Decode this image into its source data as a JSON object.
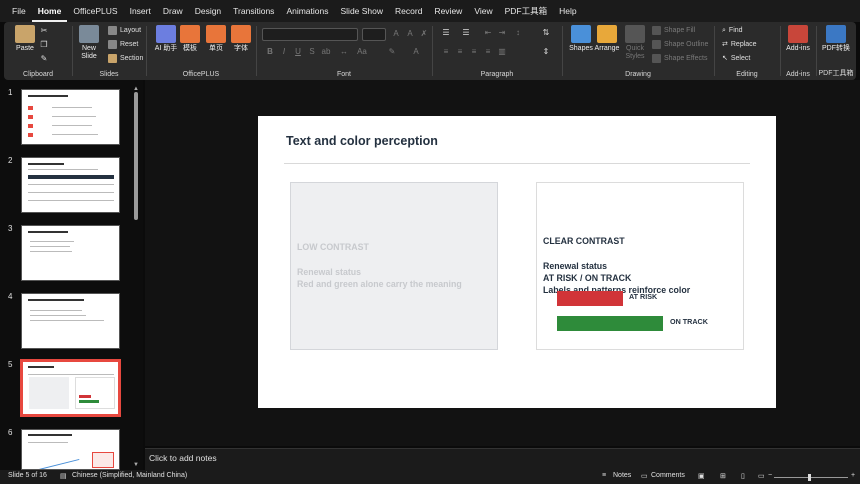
{
  "menu": [
    "File",
    "Home",
    "OfficePLUS",
    "Insert",
    "Draw",
    "Design",
    "Transitions",
    "Animations",
    "Slide Show",
    "Record",
    "Review",
    "View",
    "PDF工具箱",
    "Help"
  ],
  "active_menu": "Home",
  "ribbon": {
    "clipboard": {
      "label": "Clipboard",
      "paste": "Paste"
    },
    "slides": {
      "label": "Slides",
      "new_slide": "New Slide",
      "layout": "Layout",
      "reset": "Reset",
      "section": "Section"
    },
    "officeplus": {
      "label": "OfficePLUS",
      "ai": "AI 助手",
      "template": "模板",
      "single_page": "单页",
      "font_tool": "字体"
    },
    "font": {
      "label": "Font"
    },
    "paragraph": {
      "label": "Paragraph"
    },
    "drawing": {
      "label": "Drawing",
      "shapes": "Shapes",
      "arrange": "Arrange",
      "quick_styles": "Quick Styles",
      "shape_fill": "Shape Fill",
      "shape_outline": "Shape Outline",
      "shape_effects": "Shape Effects"
    },
    "editing": {
      "label": "Editing",
      "find": "Find",
      "replace": "Replace",
      "select": "Select"
    },
    "addins": {
      "label": "Add-ins",
      "button": "Add-ins"
    },
    "pdf": {
      "label": "PDF工具箱",
      "button": "PDF转换"
    }
  },
  "thumbnails": {
    "numbers": [
      "1",
      "2",
      "3",
      "4",
      "5",
      "6"
    ],
    "selected": 5
  },
  "slide": {
    "title": "Text and color perception",
    "low_contrast": {
      "heading": "LOW CONTRAST",
      "line1": "Renewal status",
      "line2": "Red and green alone carry the meaning"
    },
    "clear_contrast": {
      "heading": "CLEAR CONTRAST",
      "line1": "Renewal status",
      "line2": "AT RISK  /  ON TRACK",
      "line3": "Labels and patterns reinforce color",
      "bar1_label": "AT RISK",
      "bar2_label": "ON TRACK"
    },
    "colors": {
      "risk": "#d13438",
      "track": "#2e8b3a",
      "text": "#243140"
    }
  },
  "notes_placeholder": "Click to add notes",
  "status": {
    "slide_counter": "Slide 5 of 16",
    "language": "Chinese (Simplified, Mainland China)",
    "notes": "Notes",
    "comments": "Comments"
  }
}
